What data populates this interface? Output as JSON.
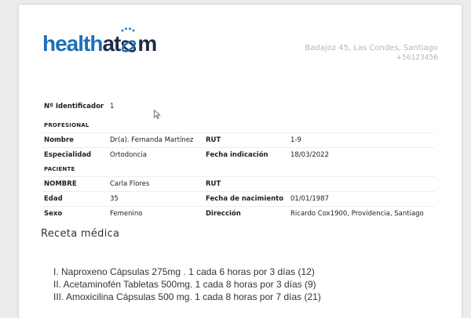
{
  "logo": {
    "part1": "health",
    "part2": "at",
    "part3": "m",
    "icon": "atom-icon",
    "colors": {
      "blue": "#1d6fb8",
      "dark": "#1f2a44"
    }
  },
  "address": {
    "street": "Badajoz 45, Las Condes, Santiago",
    "phone": "+56123456"
  },
  "identifier": {
    "label": "Nº Identificador",
    "value": "1"
  },
  "profesional": {
    "section": "PROFESIONAL",
    "nombre_label": "Nombre",
    "nombre": "Dr(a). Fernanda Martínez",
    "rut_label": "RUT",
    "rut": "1-9",
    "especialidad_label": "Especialidad",
    "especialidad": "Ortodoncia",
    "fecha_label": "Fecha indicación",
    "fecha": "18/03/2022"
  },
  "paciente": {
    "section": "PACIENTE",
    "nombre_label": "NOMBRE",
    "nombre": "Carla Flores",
    "rut_label": "RUT",
    "rut": "",
    "edad_label": "Edad",
    "edad": "35",
    "nacimiento_label": "Fecha de nacimiento",
    "nacimiento": "01/01/1987",
    "sexo_label": "Sexo",
    "sexo": "Femenino",
    "direccion_label": "Dirección",
    "direccion": "Ricardo Cox1900, Providencia, Santiago"
  },
  "receta": {
    "title": "Receta médica",
    "items": [
      "I. Naproxeno Cápsulas 275mg . 1 cada 6 horas por 3 días (12)",
      "II. Acetaminofén Tabletas 500mg. 1 cada 8 horas por 3 días (9)",
      "III. Amoxicilina Cápsulas 500 mg. 1 cada 8 horas por 7 días (21)"
    ]
  }
}
